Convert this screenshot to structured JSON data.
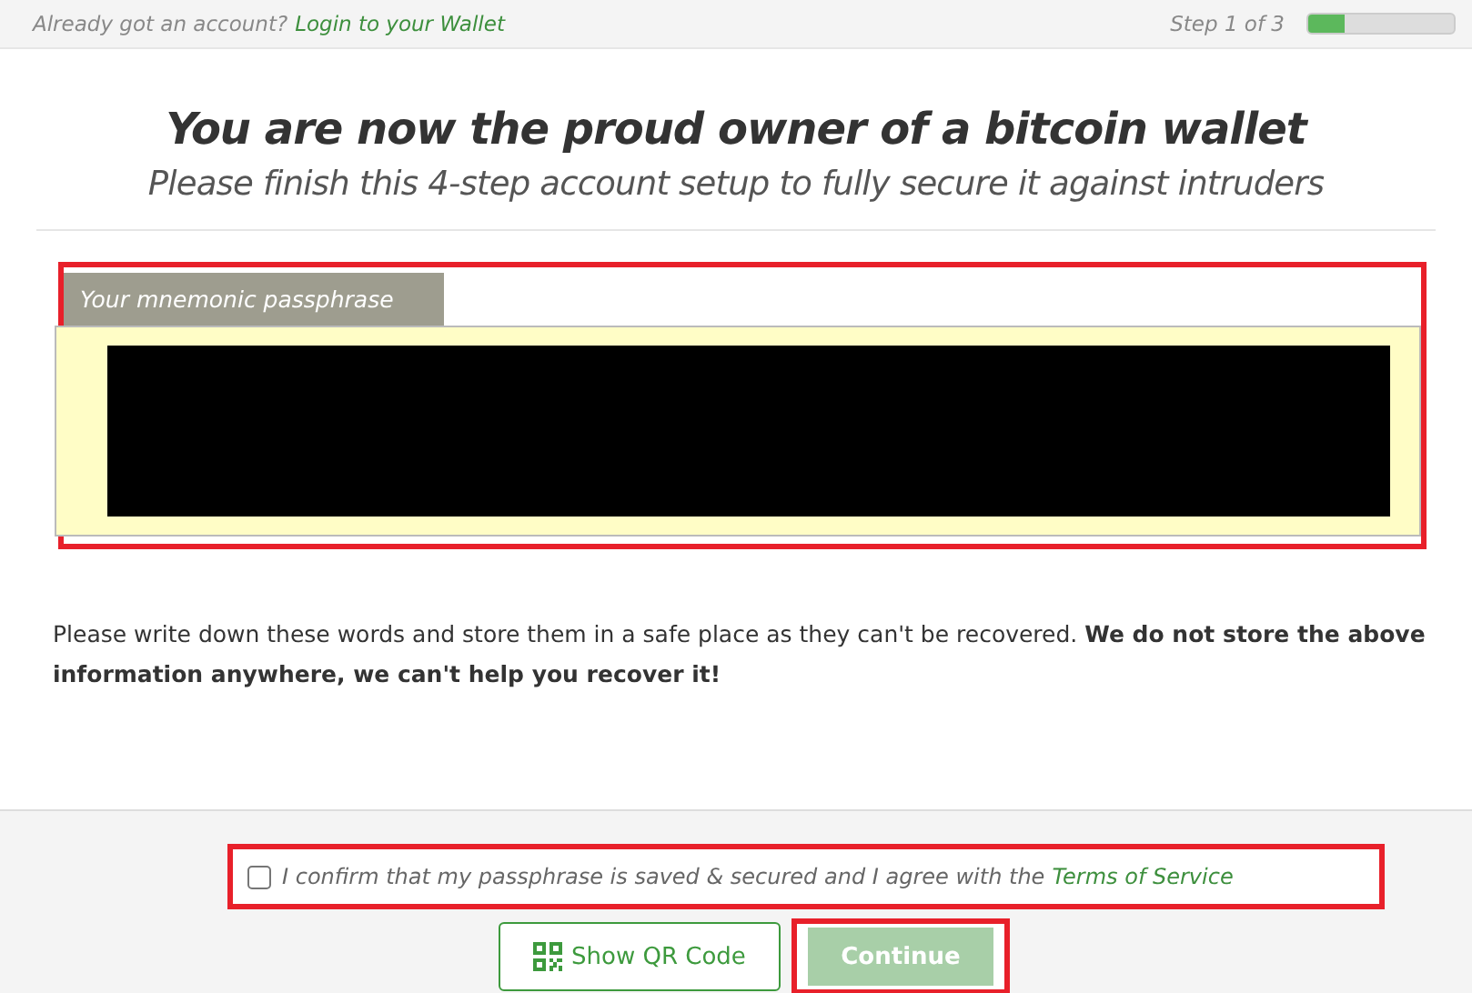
{
  "top_bar": {
    "prompt": "Already got an account?",
    "login_link": "Login to your Wallet",
    "step": "Step 1 of 3",
    "progress": {
      "level": 0.25
    }
  },
  "heading": {
    "title": "You are now the proud owner of a bitcoin wallet",
    "subtitle": "Please finish this 4-step account setup to fully secure it against intruders"
  },
  "passphrase": {
    "label": "Your mnemonic passphrase"
  },
  "notice": "Please write down these words and store them in a safe place as they can't be recovered. **We do not store the above information anywhere, we can't help you recover it!**",
  "confirm": {
    "checked": false,
    "text": "I confirm that my passphrase is saved & secured and I agree with the",
    "link": "Terms of Service"
  },
  "buttons": [
    {
      "kind": "qr",
      "label": "Show QR Code",
      "disabled": false
    },
    {
      "kind": "primary",
      "label": "Continue",
      "disabled": true
    }
  ]
}
